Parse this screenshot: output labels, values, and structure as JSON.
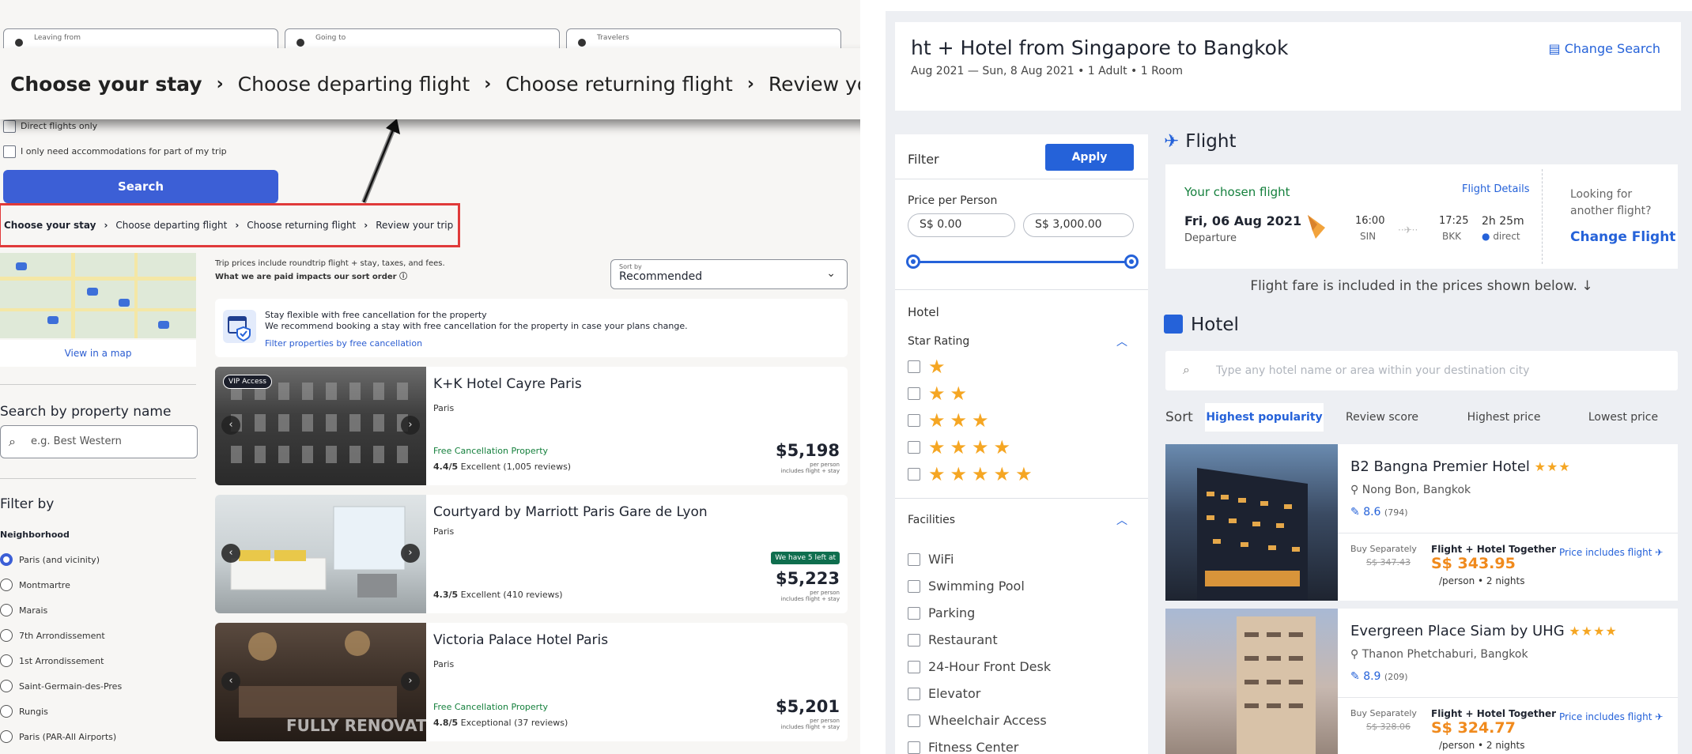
{
  "left": {
    "top_fields": [
      {
        "label": "Leaving from"
      },
      {
        "label": "Going to"
      },
      {
        "label": "Travelers"
      }
    ],
    "direct_flights_label": "Direct flights only",
    "partial_stay_label": "I only need accommodations for part of my trip",
    "search_button": "Search",
    "breadcrumb": [
      "Choose your stay",
      "Choose departing flight",
      "Choose returning flight",
      "Review your trip"
    ],
    "breadcrumb_sep": "›",
    "overlay_breadcrumb": [
      "Choose your stay",
      "Choose departing flight",
      "Choose returning flight",
      "Review your trip"
    ],
    "view_map": "View in a map",
    "search_property_title": "Search by property name",
    "search_property_placeholder": "e.g. Best Western",
    "filter_title": "Filter by",
    "neighborhood_title": "Neighborhood",
    "neighborhoods": [
      "Paris (and vicinity)",
      "Montmartre",
      "Marais",
      "7th Arrondissement",
      "1st Arrondissement",
      "Saint-Germain-des-Pres",
      "Rungis",
      "Paris (PAR-All Airports)"
    ],
    "trip_note_1": "Trip prices include roundtrip flight + stay, taxes, and fees.",
    "trip_note_2": "What we are paid impacts our sort order",
    "sort_label": "Sort by",
    "sort_value": "Recommended",
    "flex_title": "Stay flexible with free cancellation for the property",
    "flex_text": "We recommend booking a stay with free cancellation for the property in case your plans change.",
    "flex_link": "Filter properties by free cancellation",
    "hotels": [
      {
        "name": "K+K Hotel Cayre Paris",
        "city": "Paris",
        "badge": "VIP Access",
        "free_cancel": "Free Cancellation Property",
        "rating": "4.4/5",
        "rating_text": "Excellent (1,005 reviews)",
        "price": "$5,198",
        "left_badge": "",
        "overlay": ""
      },
      {
        "name": "Courtyard by Marriott Paris Gare de Lyon",
        "city": "Paris",
        "badge": "",
        "free_cancel": "",
        "rating": "4.3/5",
        "rating_text": "Excellent (410 reviews)",
        "price": "$5,223",
        "left_badge": "We have 5 left at",
        "overlay": ""
      },
      {
        "name": "Victoria Palace Hotel Paris",
        "city": "Paris",
        "badge": "",
        "free_cancel": "Free Cancellation Property",
        "rating": "4.8/5",
        "rating_text": "Exceptional (37 reviews)",
        "price": "$5,201",
        "left_badge": "",
        "overlay": "FULLY RENOVATED"
      }
    ],
    "per_person": "per person",
    "includes": "includes flight + stay"
  },
  "right": {
    "title": "ht + Hotel from Singapore to Bangkok",
    "subtitle": "Aug 2021 — Sun, 8 Aug 2021 • 1 Adult • 1 Room",
    "change_search": "Change Search",
    "filter": {
      "title": "Filter",
      "apply": "Apply",
      "price_label": "Price per Person",
      "price_min": "S$ 0.00",
      "price_max": "S$ 3,000.00",
      "hotel_label": "Hotel",
      "star_label": "Star Rating",
      "facilities_label": "Facilities",
      "facilities": [
        "WiFi",
        "Swimming Pool",
        "Parking",
        "Restaurant",
        "24-Hour Front Desk",
        "Elevator",
        "Wheelchair Access",
        "Fitness Center"
      ]
    },
    "flight": {
      "heading": "Flight",
      "chosen": "Your chosen flight",
      "details": "Flight Details",
      "date": "Fri, 06 Aug 2021",
      "departure": "Departure",
      "dep_time": "16:00",
      "dep_code": "SIN",
      "arr_time": "17:25",
      "arr_code": "BKK",
      "duration": "2h 25m",
      "direct": "direct",
      "looking": "Looking for another flight?",
      "change_flight": "Change Flight"
    },
    "fare_note": "Flight fare is included in the prices shown below. ↓",
    "hotel_heading": "Hotel",
    "hotel_search_placeholder": "Type any hotel name or area within your destination city",
    "sort_label": "Sort",
    "sort_tabs": [
      "Highest popularity",
      "Review score",
      "Highest price",
      "Lowest price"
    ],
    "hotels": [
      {
        "name": "B2 Bangna Premier Hotel",
        "stars": "★★★",
        "location": "Nong Bon, Bangkok",
        "score": "8.6",
        "reviews": "(794)",
        "buy_sep": "Buy Separately",
        "old_price": "S$ 347.43",
        "together": "Flight + Hotel Together",
        "price": "S$ 343.95",
        "per": "/person • 2 nights",
        "pif": "Price includes flight ✈"
      },
      {
        "name": "Evergreen Place Siam by UHG",
        "stars": "★★★★",
        "location": "Thanon Phetchaburi, Bangkok",
        "score": "8.9",
        "reviews": "(209)",
        "buy_sep": "Buy Separately",
        "old_price": "S$ 328.06",
        "together": "Flight + Hotel Together",
        "price": "S$ 324.77",
        "per": "/person • 2 nights",
        "pif": "Price includes flight ✈"
      }
    ]
  },
  "colors": {
    "accent_blue": "#2562d9",
    "expedia_blue": "#3c5fd6",
    "highlight_red": "#e03a3a",
    "price_orange": "#f08a1d",
    "star_gold": "#f5a623"
  }
}
